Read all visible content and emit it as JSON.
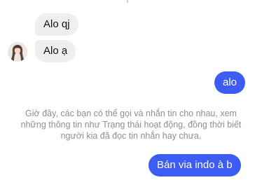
{
  "conversation": {
    "messages": [
      {
        "direction": "incoming",
        "text": "Alo qj"
      },
      {
        "direction": "incoming",
        "text": "Alo ạ"
      },
      {
        "direction": "outgoing",
        "text": "alo"
      },
      {
        "direction": "outgoing",
        "text": "Bán via indo à b"
      }
    ],
    "notice": {
      "lines": [
        "Giờ đây, các bạn có thể gọi và nhắn tin cho nhau, xem",
        "những thông tin như Trạng thái hoạt động, đồng thời biết",
        "người kia đã đọc tin nhắn hay chưa."
      ]
    }
  },
  "colors": {
    "outgoing_bubble": "#3c5cf2",
    "incoming_bubble": "#efeff1",
    "notice_text": "#8e8e93"
  },
  "icons": {
    "contact_avatar": "contact-avatar"
  }
}
